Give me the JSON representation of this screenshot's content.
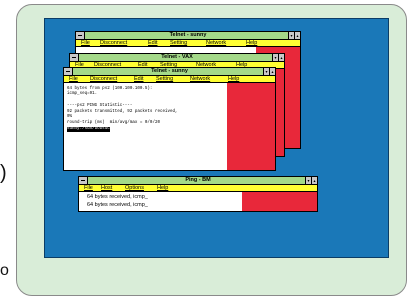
{
  "margin": {
    "right_paren": ")",
    "letter": "o"
  },
  "windows": {
    "sunny_back": {
      "title": "Telnet - sunny",
      "menu": [
        "File",
        "Disconnect",
        "Edit",
        "Setting",
        "Network",
        "Help"
      ]
    },
    "vax": {
      "title": "Telnet - VAX",
      "menu": [
        "File",
        "Disconnect",
        "Edit",
        "Setting",
        "Network",
        "Help"
      ]
    },
    "sunny_front": {
      "title": "Telnet - sunny",
      "menu": [
        "File",
        "Disconnect",
        "Edit",
        "Setting",
        "Network",
        "Help"
      ],
      "lines": [
        "64 bytes from ps2 (100.100.100.5):",
        "icmp_seq=91.",
        "",
        "----ps2 PING Statistic----",
        "92 packets transmitted, 92 packets received,",
        "0%",
        "round-trip (ms)  min/avg/max = 0/0/20",
        "sunny:/sun/bobsuc"
      ]
    },
    "ping": {
      "title": "Ping - BM",
      "menu": [
        "File",
        "Host",
        "Options",
        "Help"
      ],
      "lines": [
        "64 bytes received, icmp_",
        "64 bytes received, icmp_"
      ]
    }
  },
  "colors": {
    "desktop": "#1a78b8",
    "titlebar": "#a4d989",
    "menubar": "#ffff33",
    "accent_red": "#e8283a",
    "frame_bg": "#d9edd8"
  }
}
